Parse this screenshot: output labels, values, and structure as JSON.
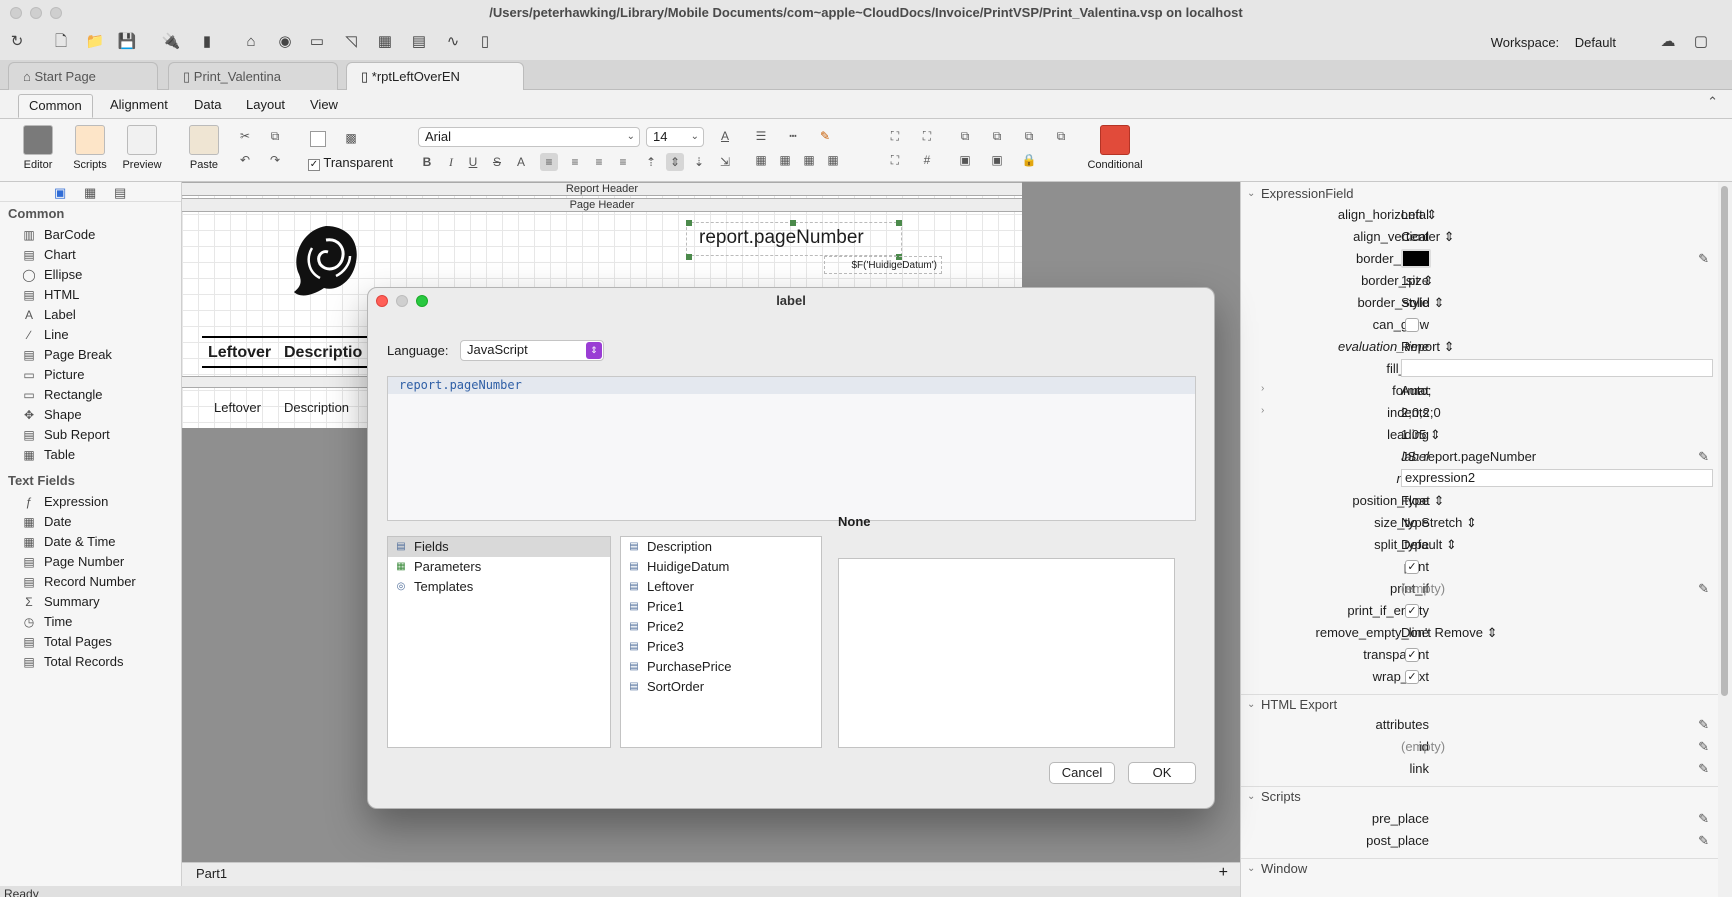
{
  "window": {
    "title": "/Users/peterhawking/Library/Mobile Documents/com~apple~CloudDocs/Invoice/PrintVSP/Print_Valentina.vsp on localhost"
  },
  "workspace": {
    "label": "Workspace:",
    "value": "Default"
  },
  "doc_tabs": [
    {
      "label": "Start Page",
      "icon": "home-icon"
    },
    {
      "label": "Print_Valentina",
      "icon": "document-icon"
    },
    {
      "label": "*rptLeftOverEN",
      "icon": "report-icon"
    }
  ],
  "ribbon_tabs": [
    "Common",
    "Alignment",
    "Data",
    "Layout",
    "View"
  ],
  "ribbon": {
    "editor": "Editor",
    "scripts": "Scripts",
    "preview": "Preview",
    "paste": "Paste",
    "transparent": "Transparent",
    "font": "Arial",
    "size": "14",
    "conditional": "Conditional"
  },
  "palette": {
    "common_header": "Common",
    "common_items": [
      "BarCode",
      "Chart",
      "Ellipse",
      "HTML",
      "Label",
      "Line",
      "Page Break",
      "Picture",
      "Rectangle",
      "Shape",
      "Sub Report",
      "Table"
    ],
    "text_header": "Text Fields",
    "text_items": [
      "Expression",
      "Date",
      "Date & Time",
      "Page Number",
      "Record Number",
      "Summary",
      "Time",
      "Total Pages",
      "Total Records"
    ]
  },
  "report": {
    "report_header": "Report Header",
    "page_header": "Page Header",
    "page_number_field": "report.pageNumber",
    "date_field": "$F('HuidigeDatum')",
    "header_labels": [
      "Leftover",
      "Descriptio"
    ],
    "detail_labels": [
      "Leftover",
      "Description"
    ]
  },
  "bottom": {
    "part": "Part1",
    "status": "Ready"
  },
  "properties": {
    "section1": "ExpressionField",
    "align_horizontal": "Left",
    "align_vertical": "Center",
    "border_size": "1pt",
    "border_style": "Solid",
    "evaluation_time": "Report",
    "format": "Auto;",
    "indents": "2;0;2;0",
    "leading": "1.05",
    "label": "JS: report.pageNumber",
    "name": "expression2",
    "position_type": "Float",
    "size_type": "No Stretch",
    "split_type": "Default",
    "print_if": "(empty)",
    "remove_empty_line": "Don't Remove",
    "section2": "HTML Export",
    "id": "(empty)",
    "section3": "Scripts",
    "section4": "Window",
    "keys": {
      "align_horizontal": "align_horizontal",
      "align_vertical": "align_vertical",
      "border_color": "border_color",
      "border_size": "border_size",
      "border_style": "border_style",
      "can_grow": "can_grow",
      "evaluation_time": "evaluation_time",
      "fill_with": "fill_with",
      "format": "format",
      "indents": "indents",
      "leading": "leading",
      "label": "label",
      "name": "name",
      "position_type": "position_type",
      "size_type": "size_type",
      "split_type": "split_type",
      "print": "print",
      "print_if": "print_if",
      "print_if_empty": "print_if_empty",
      "remove_empty_line": "remove_empty_line",
      "transparent": "transparent",
      "wrap_text": "wrap_text",
      "attributes": "attributes",
      "id": "id",
      "link": "link",
      "pre_place": "pre_place",
      "post_place": "post_place"
    },
    "colors": {
      "border_color": "#000000"
    }
  },
  "dialog": {
    "title": "label",
    "language_label": "Language:",
    "language_value": "JavaScript",
    "code": "report.pageNumber",
    "categories": [
      "Fields",
      "Parameters",
      "Templates"
    ],
    "fields": [
      "Description",
      "HuidigeDatum",
      "Leftover",
      "Price1",
      "Price2",
      "Price3",
      "PurchasePrice",
      "SortOrder"
    ],
    "detail_title": "None",
    "cancel": "Cancel",
    "ok": "OK"
  }
}
